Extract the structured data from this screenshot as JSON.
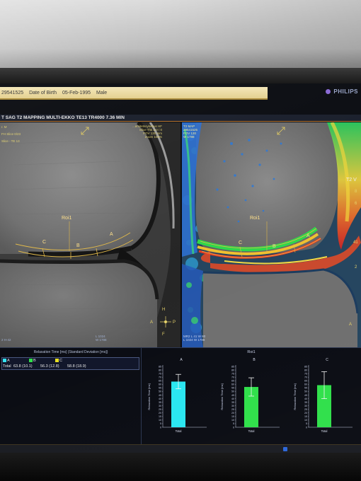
{
  "patient": {
    "id": "29541525",
    "dob_label": "Date of Birth",
    "dob": "05-Feb-1995",
    "sex": "Male"
  },
  "vendor": "PHILIPS",
  "series_title": "T SAG T2 MAPPING MULTI-EKKO TE13 TR4000 7.36 MIN",
  "left_view": {
    "info_top_right": "...ersitetssykehus HF\nSlice Thk 3.0 / 0\nFOV 130 mm\nZoom 159%",
    "info_top_left": "r. M\n\nFH Slice 0/23\n\nSlice - TE 13",
    "roi_name": "Roi1",
    "segment_labels": [
      "C",
      "B",
      "A"
    ],
    "orientation": {
      "top": "H",
      "left": "A",
      "right": "P",
      "bottom": "F"
    },
    "wl": "L 1024\nW 1788",
    "corner_br": "2 H-42"
  },
  "right_view": {
    "info_top_left": "T2 MAP\n29541525\nFOV 130\nW 1788",
    "roi_name": "Roi1",
    "segment_labels": [
      "C",
      "B",
      "A"
    ],
    "edge_label": "T2 V",
    "scale_ticks": [
      "8",
      "6",
      "41",
      "2"
    ],
    "orientation": {
      "left": "A"
    },
    "wl": "MR2 L 41 W 80\nL 1024 W 1788"
  },
  "relaxation_table": {
    "header": "Relaxation Time [ms] (Standard Deviation [ms])",
    "row_label": "Total",
    "columns": [
      {
        "label": "A",
        "value": "63.8 (10.1)",
        "color": "#35e4f2"
      },
      {
        "label": "B",
        "value": "56.3 (12.8)",
        "color": "#2fe24a"
      },
      {
        "label": "C",
        "value": "58.8 (18.9)",
        "color": "#e8e020"
      }
    ]
  },
  "chart_title": "Roi1",
  "chart_data": [
    {
      "type": "bar",
      "title": "A",
      "categories": [
        "Total"
      ],
      "values": [
        63.8
      ],
      "error": [
        10.1
      ],
      "ylabel": "Relaxation Time [ms]",
      "ylim": [
        0,
        85
      ],
      "color": "#29e6f0",
      "grid": false
    },
    {
      "type": "bar",
      "title": "B",
      "categories": [
        "Total"
      ],
      "values": [
        56.3
      ],
      "error": [
        12.8
      ],
      "ylabel": "Relaxation Time [ms]",
      "ylim": [
        0,
        85
      ],
      "color": "#2fe04a",
      "grid": false
    },
    {
      "type": "bar",
      "title": "C",
      "categories": [
        "Total"
      ],
      "values": [
        58.8
      ],
      "error": [
        18.9
      ],
      "ylabel": "Relaxation Time [ms]",
      "ylim": [
        0,
        85
      ],
      "color": "#2fe04a",
      "grid": false
    }
  ],
  "y_ticks": [
    "0",
    "5",
    "10",
    "15",
    "20",
    "25",
    "30",
    "35",
    "40",
    "45",
    "50",
    "55",
    "60",
    "65",
    "70",
    "75",
    "80",
    "85"
  ]
}
